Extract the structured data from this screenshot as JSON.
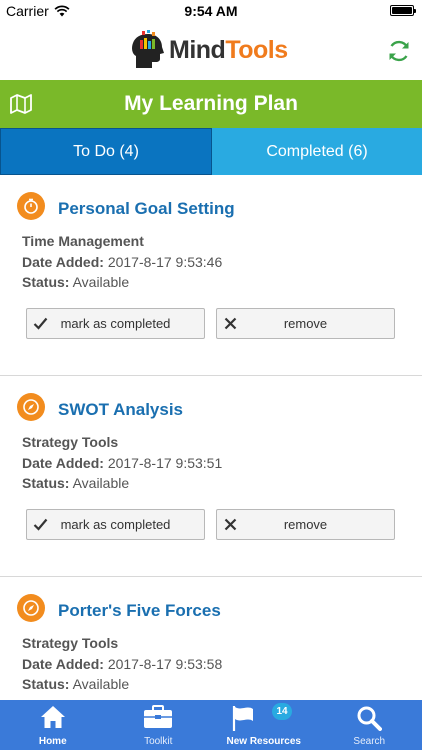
{
  "status_bar": {
    "carrier": "Carrier",
    "time": "9:54 AM"
  },
  "header": {
    "logo_mind": "Mind",
    "logo_tools": "Tools"
  },
  "title_bar": {
    "title": "My Learning Plan"
  },
  "tabs": [
    {
      "label": "To Do (4)",
      "active": true
    },
    {
      "label": "Completed (6)",
      "active": false
    }
  ],
  "labels": {
    "date_added": "Date Added:",
    "status": "Status:",
    "mark_completed": "mark as completed",
    "remove": "remove"
  },
  "items": [
    {
      "title": "Personal Goal Setting",
      "category": "Time Management",
      "date_added": "2017-8-17 9:53:46",
      "status": "Available",
      "icon": "stopwatch-icon"
    },
    {
      "title": "SWOT Analysis",
      "category": "Strategy Tools",
      "date_added": "2017-8-17 9:53:51",
      "status": "Available",
      "icon": "compass-icon"
    },
    {
      "title": "Porter's Five Forces",
      "category": "Strategy Tools",
      "date_added": "2017-8-17 9:53:58",
      "status": "Available",
      "icon": "compass-icon"
    }
  ],
  "bottom_nav": [
    {
      "label": "Home",
      "icon": "home-icon"
    },
    {
      "label": "Toolkit",
      "icon": "toolkit-icon"
    },
    {
      "label": "New Resources",
      "icon": "flag-icon",
      "badge": "14"
    },
    {
      "label": "Search",
      "icon": "search-icon"
    }
  ],
  "colors": {
    "green_bar": "#7ab929",
    "tab_active": "#0a74c0",
    "tab_inactive": "#29aae1",
    "title_blue": "#1a6fb0",
    "orange": "#f28c1e",
    "nav_blue": "#3a7ad9"
  }
}
